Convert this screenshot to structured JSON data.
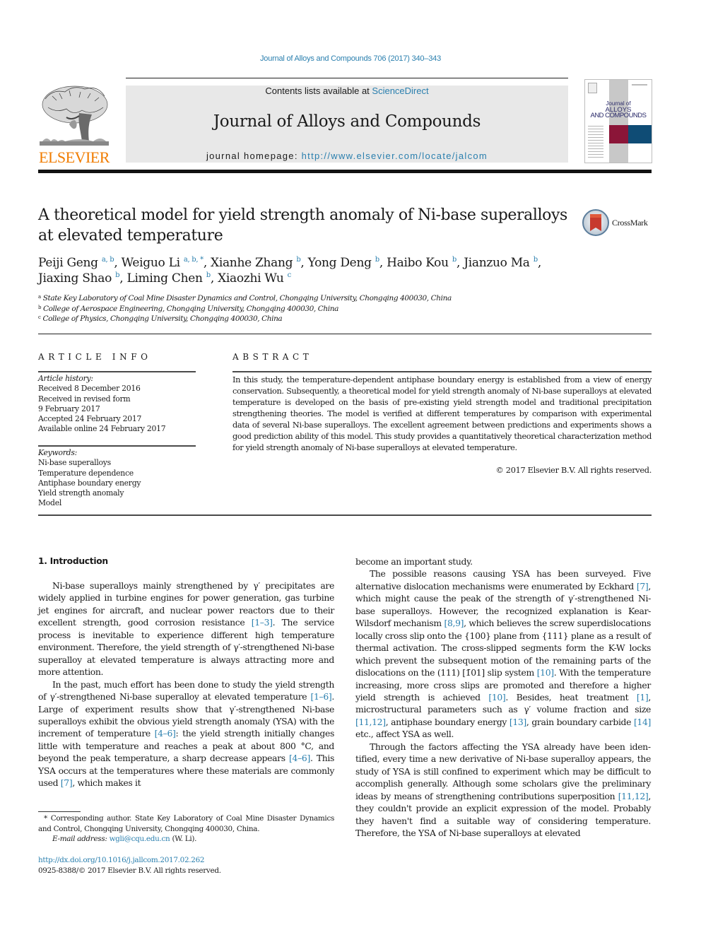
{
  "citation": "Journal of Alloys and Compounds 706 (2017) 340–343",
  "header": {
    "contents_prefix": "Contents lists available at ",
    "contents_link": "ScienceDirect",
    "journal_name": "Journal of Alloys and Compounds",
    "homepage_prefix": "journal homepage: ",
    "homepage_url": "http://www.elsevier.com/locate/jalcom",
    "publisher_logo_text": "ELSEVIER",
    "cover": {
      "line1": "Journal of",
      "line2": "ALLOYS",
      "line3": "AND COMPOUNDS",
      "colors": {
        "crimson": "#8b1538",
        "blue": "#0f4c75",
        "grey": "#c8c8c8"
      }
    },
    "colors": {
      "link": "#2a7fae",
      "elsevier_orange": "#f07c00",
      "banner": "#e8e8e8"
    }
  },
  "article": {
    "title_line1": "A theoretical model for yield strength anomaly of Ni-base superalloys",
    "title_line2": "at elevated temperature",
    "crossmark_label": "CrossMark",
    "authors_line1": [
      {
        "name": "Peiji Geng",
        "sup": "a, b",
        "sep": ", "
      },
      {
        "name": "Weiguo Li",
        "sup": "a, b, *",
        "sep": ", "
      },
      {
        "name": "Xianhe Zhang",
        "sup": "b",
        "sep": ", "
      },
      {
        "name": "Yong Deng",
        "sup": "b",
        "sep": ", "
      },
      {
        "name": "Haibo Kou",
        "sup": "b",
        "sep": ", "
      },
      {
        "name": "Jianzuo Ma",
        "sup": "b",
        "sep": ","
      }
    ],
    "authors_line2": [
      {
        "name": "Jiaxing Shao",
        "sup": "b",
        "sep": ", "
      },
      {
        "name": "Liming Chen",
        "sup": "b",
        "sep": ", "
      },
      {
        "name": "Xiaozhi Wu",
        "sup": "c",
        "sep": ""
      }
    ],
    "affiliations": [
      {
        "key": "a",
        "text": "State Key Laboratory of Coal Mine Disaster Dynamics and Control, Chongqing University, Chongqing 400030, China"
      },
      {
        "key": "b",
        "text": "College of Aerospace Engineering, Chongqing University, Chongqing 400030, China"
      },
      {
        "key": "c",
        "text": "College of Physics, Chongqing University, Chongqing 400030, China"
      }
    ]
  },
  "article_info": {
    "heading": "ARTICLE INFO",
    "history_label": "Article history:",
    "history": [
      "Received 8 December 2016",
      "Received in revised form",
      "9 February 2017",
      "Accepted 24 February 2017",
      "Available online 24 February 2017"
    ],
    "keywords_label": "Keywords:",
    "keywords": [
      "Ni-base superalloys",
      "Temperature dependence",
      "Antiphase boundary energy",
      "Yield strength anomaly",
      "Model"
    ]
  },
  "abstract": {
    "heading": "ABSTRACT",
    "text": "In this study, the temperature-dependent antiphase boundary energy is established from a view of energy conservation. Subsequently, a theoretical model for yield strength anomaly of Ni-base superalloys at elevated temperature is developed on the basis of pre-existing yield strength model and traditional precipitation strengthening theories. The model is verified at different temperatures by comparison with experimental data of several Ni-base superalloys. The excellent agreement between predictions and experiments shows a good prediction ability of this model. This study provides a quantitatively theo­retical characterization method for yield strength anomaly of Ni-base superalloys at elevated temperature.",
    "copyright": "© 2017 Elsevier B.V. All rights reserved."
  },
  "body": {
    "section_heading": "1.  Introduction",
    "left_paragraphs": [
      [
        {
          "t": "Ni-base superalloys mainly strengthened by γ′ precipitates are widely applied in turbine engines for power generation, gas turbine jet engines for aircraft, and nuclear power reactors due to their excellent strength, good corrosion resistance "
        },
        {
          "ref": "[1–3]"
        },
        {
          "t": ". The service process is inevitable to experience different high temperature environment. Therefore, the yield strength of γ′-strengthened Ni-base superalloy at elevated temperature is always attracting more and more attention."
        }
      ],
      [
        {
          "t": "In the past, much effort has been done to study the yield strength of γ′-strengthened Ni-base superalloy at elevated tem­perature "
        },
        {
          "ref": "[1–6]"
        },
        {
          "t": ". Large of experiment results show that γ′-strengthened Ni-base superalloys exhibit the obvious yield strength anomaly (YSA) with the increment of temperature "
        },
        {
          "ref": "[4–6]"
        },
        {
          "t": ": the yield strength initially changes little with temperature and reaches a peak at about 800 °C, and beyond the peak temperature, a sharp decrease appears "
        },
        {
          "ref": "[4–6]"
        },
        {
          "t": ". This YSA occurs at the temperatures where these materials are commonly used "
        },
        {
          "ref": "[7]"
        },
        {
          "t": ", which makes it"
        }
      ]
    ],
    "right_continuation": "become an important study.",
    "right_paragraphs": [
      [
        {
          "t": "The possible reasons causing YSA has been surveyed. Five alternative dislocation mechanisms were enumerated by Eckhard "
        },
        {
          "ref": "[7]"
        },
        {
          "t": ", which might cause the peak of the strength of γ′-strengthened Ni-base superalloys. However, the recognized explanation is Kear-Wilsdorf mechanism "
        },
        {
          "ref": "[8,9]"
        },
        {
          "t": ", which believes the screw super­dislocations locally cross slip onto the {100} plane from {111} plane as a result of thermal activation. The cross-slipped segments form the K-W locks which prevent the subsequent motion of the remaining parts of the dislocations on the (111) [1̄01] slip system "
        },
        {
          "ref": "[10]"
        },
        {
          "t": ". With the temperature increasing, more cross slips are pro­moted and therefore a higher yield strength is achieved "
        },
        {
          "ref": "[10]"
        },
        {
          "t": ". Be­sides, heat treatment "
        },
        {
          "ref": "[1]"
        },
        {
          "t": ", microstructural parameters such as γ′ volume fraction and size "
        },
        {
          "ref": "[11,12]"
        },
        {
          "t": ", antiphase boundary energy "
        },
        {
          "ref": "[13]"
        },
        {
          "t": ", grain boundary carbide "
        },
        {
          "ref": "[14]"
        },
        {
          "t": " etc., affect YSA as well."
        }
      ],
      [
        {
          "t": "Through the factors affecting the YSA already have been iden­tified, every time a new derivative of Ni-base superalloy appears, the study of YSA is still confined to experiment which may be difficult to accomplish generally. Although some scholars give the preliminary ideas by means of strengthening contributions super­position "
        },
        {
          "ref": "[11,12]"
        },
        {
          "t": ", they couldn't provide an explicit expression of the model. Probably they haven't find a suitable way of considering temperature. Therefore, the YSA of Ni-base superalloys at elevated"
        }
      ]
    ]
  },
  "footnote": {
    "corresponding": "* Corresponding author. State Key Laboratory of Coal Mine Disaster Dynamics and Control, Chongqing University, Chongqing 400030, China.",
    "email_label": "E-mail address: ",
    "email": "wgli@cqu.edu.cn",
    "email_suffix": " (W. Li).",
    "doi": "http://dx.doi.org/10.1016/j.jallcom.2017.02.262",
    "issn_copyright": "0925-8388/© 2017 Elsevier B.V. All rights reserved."
  }
}
